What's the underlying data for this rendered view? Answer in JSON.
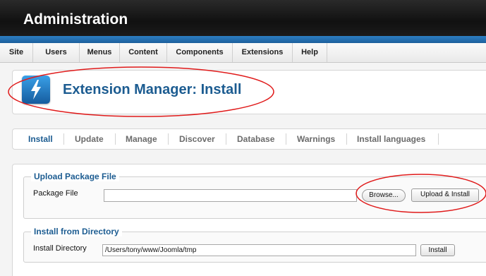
{
  "header": {
    "title": "Administration"
  },
  "menu": {
    "items": [
      {
        "label": "Site"
      },
      {
        "label": "Users"
      },
      {
        "label": "Menus"
      },
      {
        "label": "Content"
      },
      {
        "label": "Components"
      },
      {
        "label": "Extensions"
      },
      {
        "label": "Help"
      }
    ]
  },
  "page": {
    "title": "Extension Manager: Install",
    "icon": "lightning-bolt-icon"
  },
  "tabs": [
    {
      "label": "Install",
      "active": true
    },
    {
      "label": "Update"
    },
    {
      "label": "Manage"
    },
    {
      "label": "Discover"
    },
    {
      "label": "Database"
    },
    {
      "label": "Warnings"
    },
    {
      "label": "Install languages"
    }
  ],
  "upload": {
    "legend": "Upload Package File",
    "label": "Package File",
    "value": "",
    "browse_label": "Browse...",
    "submit_label": "Upload & Install"
  },
  "directory": {
    "legend": "Install from Directory",
    "label": "Install Directory",
    "value": "/Users/tony/www/Joomla/tmp",
    "submit_label": "Install"
  },
  "colors": {
    "accent": "#1c5c91",
    "stripe": "#2d7fc4",
    "annotation": "#e01a1a"
  }
}
